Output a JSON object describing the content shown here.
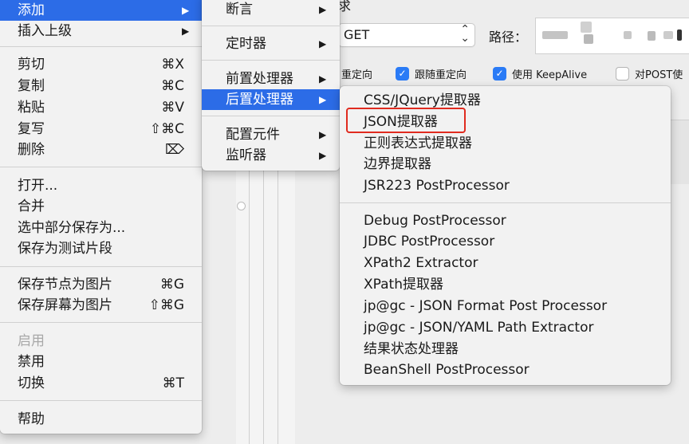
{
  "background": {
    "title_fragment": "求",
    "method_select": {
      "value": "GET",
      "chevron": "⌃⌄"
    },
    "path_label": "路径：",
    "options": [
      {
        "label": "重定向",
        "checked": false,
        "partial": true
      },
      {
        "label": "跟随重定向",
        "checked": true
      },
      {
        "label": "使用 KeepAlive",
        "checked": true
      },
      {
        "label": "对POST使",
        "checked": false
      }
    ]
  },
  "main_menu": {
    "items": [
      {
        "label": "添加",
        "shortcut": "",
        "arrow": "▶",
        "selected": true
      },
      {
        "label": "插入上级",
        "shortcut": "",
        "arrow": "▶"
      },
      {
        "label": "剪切",
        "shortcut": "⌘X"
      },
      {
        "label": "复制",
        "shortcut": "⌘C"
      },
      {
        "label": "粘贴",
        "shortcut": "⌘V"
      },
      {
        "label": "复写",
        "shortcut": "⇧⌘C"
      },
      {
        "label": "删除",
        "shortcut": "⌦"
      },
      {
        "label": "打开...",
        "shortcut": ""
      },
      {
        "label": "合并",
        "shortcut": ""
      },
      {
        "label": "选中部分保存为...",
        "shortcut": ""
      },
      {
        "label": "保存为测试片段",
        "shortcut": ""
      },
      {
        "label": "保存节点为图片",
        "shortcut": "⌘G"
      },
      {
        "label": "保存屏幕为图片",
        "shortcut": "⇧⌘G"
      },
      {
        "label": "启用",
        "shortcut": "",
        "disabled": true
      },
      {
        "label": "禁用",
        "shortcut": ""
      },
      {
        "label": "切换",
        "shortcut": "⌘T"
      },
      {
        "label": "帮助",
        "shortcut": ""
      }
    ]
  },
  "add_submenu": {
    "items": [
      {
        "label": "断言",
        "arrow": "▶"
      },
      {
        "label": "定时器",
        "arrow": "▶"
      },
      {
        "label": "前置处理器",
        "arrow": "▶"
      },
      {
        "label": "后置处理器",
        "arrow": "▶",
        "selected": true
      },
      {
        "label": "配置元件",
        "arrow": "▶"
      },
      {
        "label": "监听器",
        "arrow": "▶"
      }
    ]
  },
  "postprocessor_menu": {
    "items": [
      {
        "label": "CSS/JQuery提取器"
      },
      {
        "label": "JSON提取器",
        "highlighted": true
      },
      {
        "label": "正则表达式提取器"
      },
      {
        "label": "边界提取器"
      },
      {
        "label": "JSR223 PostProcessor"
      },
      {
        "label": "Debug PostProcessor"
      },
      {
        "label": "JDBC PostProcessor"
      },
      {
        "label": "XPath2 Extractor"
      },
      {
        "label": "XPath提取器"
      },
      {
        "label": "jp@gc - JSON Format Post Processor"
      },
      {
        "label": "jp@gc - JSON/YAML Path Extractor"
      },
      {
        "label": "结果状态处理器"
      },
      {
        "label": "BeanShell PostProcessor"
      }
    ]
  },
  "colors": {
    "selection": "#2c6ce7",
    "highlight_border": "#e02b1f",
    "checkbox_on": "#2a7bf6"
  }
}
